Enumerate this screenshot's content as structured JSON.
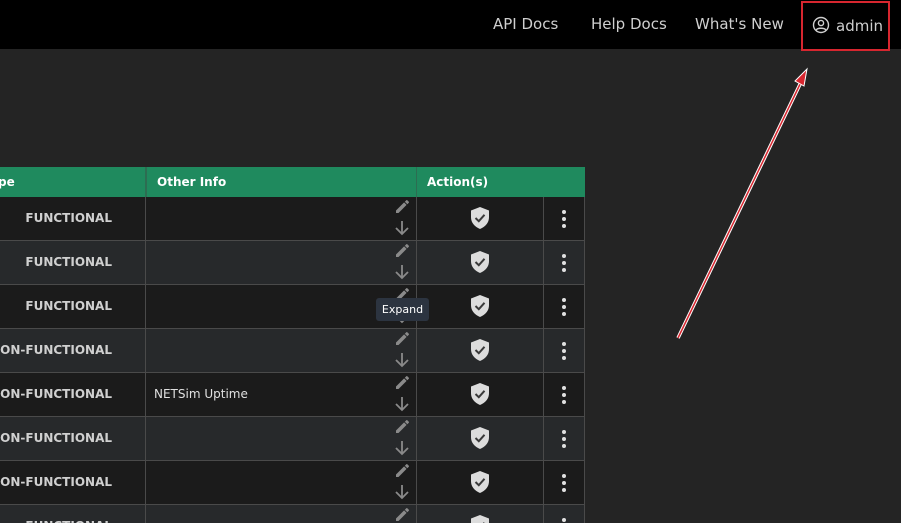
{
  "topbar": {
    "links": [
      {
        "label": "API Docs"
      },
      {
        "label": "Help Docs"
      },
      {
        "label": "What's New"
      }
    ],
    "user": {
      "name": "admin",
      "icon": "user-circle-icon"
    }
  },
  "table": {
    "headers": {
      "type": "pe",
      "other_info": "Other Info",
      "actions": "Action(s)"
    },
    "rows": [
      {
        "type": "FUNCTIONAL",
        "other_info": ""
      },
      {
        "type": "FUNCTIONAL",
        "other_info": ""
      },
      {
        "type": "FUNCTIONAL",
        "other_info": ""
      },
      {
        "type": "NON-FUNCTIONAL",
        "other_info": ""
      },
      {
        "type": "NON-FUNCTIONAL",
        "other_info": "NETSim Uptime"
      },
      {
        "type": "NON-FUNCTIONAL",
        "other_info": ""
      },
      {
        "type": "NON-FUNCTIONAL",
        "other_info": ""
      },
      {
        "type": "FUNCTIONAL",
        "other_info": ""
      }
    ],
    "icons": {
      "edit": "pencil-icon",
      "expand": "arrow-down-icon",
      "action": "shield-check-icon",
      "more": "kebab-menu-icon"
    }
  },
  "tooltip": {
    "text": "Expand"
  },
  "colors": {
    "header_bg": "#1f8a5e",
    "topbar_bg": "#000000",
    "highlight": "#d7262f",
    "page_bg": "#242424"
  }
}
